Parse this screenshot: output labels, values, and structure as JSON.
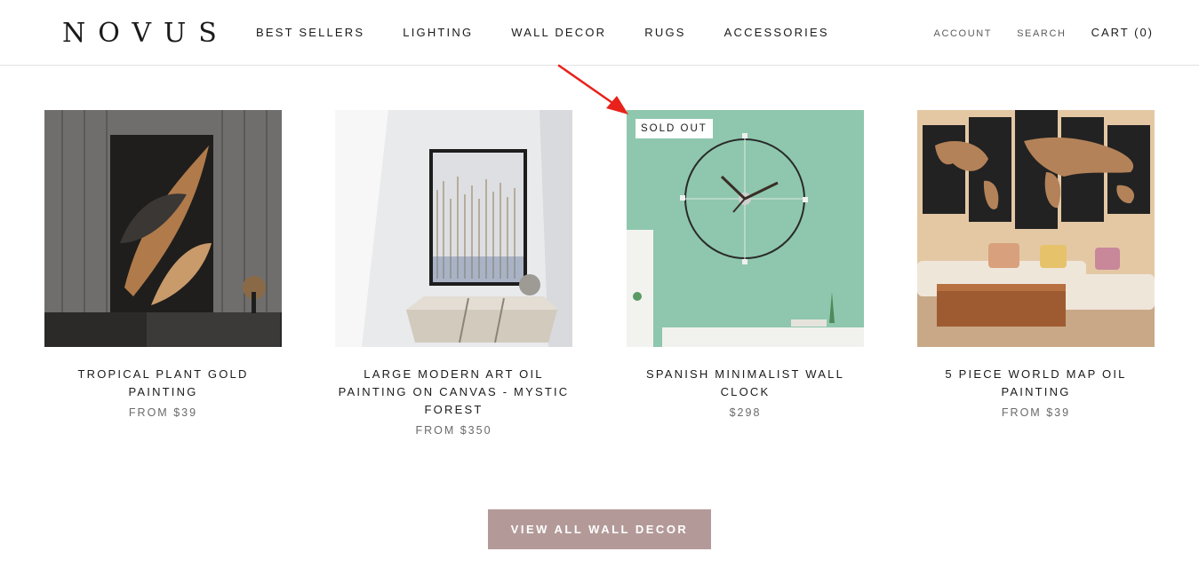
{
  "brand": {
    "logo_text": "NOVUS"
  },
  "nav": {
    "items": [
      "BEST SELLERS",
      "LIGHTING",
      "WALL DECOR",
      "RUGS",
      "ACCESSORIES"
    ],
    "account": "ACCOUNT",
    "search": "SEARCH",
    "cart": "CART (0)"
  },
  "products": [
    {
      "title": "TROPICAL PLANT GOLD PAINTING",
      "price": "FROM $39",
      "badge": ""
    },
    {
      "title": "LARGE MODERN ART OIL PAINTING ON CANVAS - MYSTIC FOREST",
      "price": "FROM $350",
      "badge": ""
    },
    {
      "title": "SPANISH MINIMALIST WALL CLOCK",
      "price": "$298",
      "badge": "SOLD OUT"
    },
    {
      "title": "5 PIECE WORLD MAP OIL PAINTING",
      "price": "FROM $39",
      "badge": ""
    }
  ],
  "cta": {
    "label": "VIEW ALL WALL DECOR"
  },
  "colors": {
    "accent": "#b39a98",
    "annotation_arrow": "#e8221a"
  }
}
